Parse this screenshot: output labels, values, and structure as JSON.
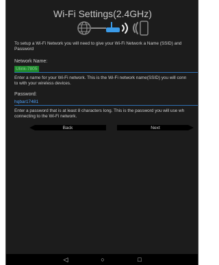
{
  "title": "Wi-Fi Settings(2.4GHz)",
  "hero": {
    "globe_icon": "globe-icon",
    "router_icon": "router-icon",
    "wifi_waves_icon": "wifi-waves-icon",
    "phone_icon": "phone-icon",
    "accent_color": "#3b9be8"
  },
  "intro": {
    "line1": "To setup a Wi-Fi Network you will need to give your Wi-Fi Network a Name (SSID) and",
    "line2": "Password"
  },
  "network": {
    "label": "Network Name:",
    "value": "Ulink-7805",
    "help_line1": "Enter a name for your Wi-Fi network. This is the Wi-Fi network name(SSID) you will conn",
    "help_line2": "to with your wireless devices."
  },
  "password": {
    "label": "Password:",
    "value": "hqbar17481",
    "help_line1": "Enter a password that is at least 8 characters long. This is the password you will use wh",
    "help_line2": "connecting to the Wi-Fi network."
  },
  "buttons": {
    "back": "Back",
    "next": "Next"
  },
  "navbar": {
    "back_glyph": "◁",
    "home_glyph": "○",
    "recents_glyph": "□"
  },
  "colors": {
    "background": "#1c1c1c",
    "input_underline": "#2f6fb2",
    "ssid_highlight": "#1f8a2e",
    "password_text": "#4ea3ff"
  }
}
